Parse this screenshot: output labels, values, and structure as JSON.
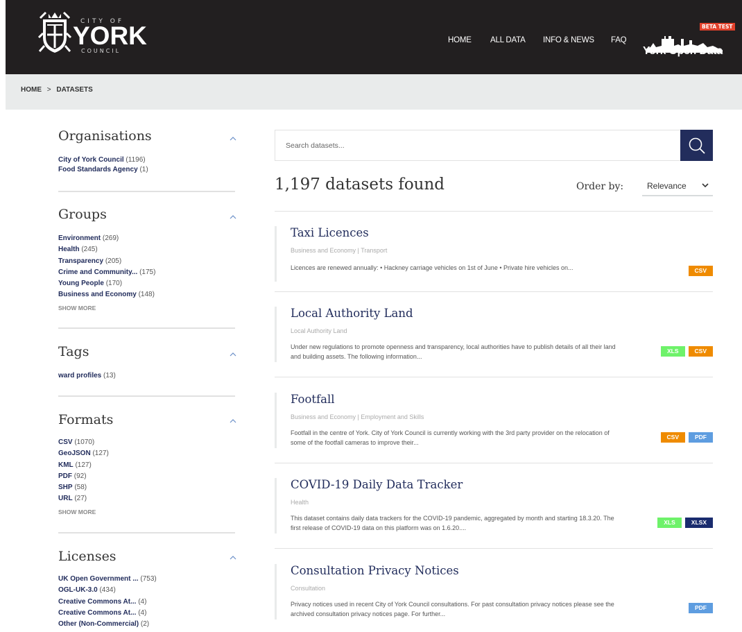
{
  "header": {
    "logo_top": "CITY OF",
    "logo_main": "YORK",
    "logo_bottom": "COUNCIL",
    "nav": [
      "HOME",
      "ALL DATA",
      "INFO & NEWS",
      "FAQ"
    ],
    "brand_title": "York Open Data",
    "beta_badge": "BETA TEST"
  },
  "breadcrumb": {
    "home": "HOME",
    "separator": ">",
    "current": "DATASETS"
  },
  "sidebar": {
    "organisations": {
      "title": "Organisations",
      "items": [
        {
          "label": "City of York Council",
          "count": "(1196)"
        },
        {
          "label": "Food Standards Agency",
          "count": "(1)"
        }
      ]
    },
    "groups": {
      "title": "Groups",
      "items": [
        {
          "label": "Environment",
          "count": "(269)"
        },
        {
          "label": "Health",
          "count": "(245)"
        },
        {
          "label": "Transparency",
          "count": "(205)"
        },
        {
          "label": "Crime and Community...",
          "count": "(175)"
        },
        {
          "label": "Young People",
          "count": "(170)"
        },
        {
          "label": "Business and Economy",
          "count": "(148)"
        }
      ],
      "show_more": "SHOW MORE"
    },
    "tags": {
      "title": "Tags",
      "items": [
        {
          "label": "ward profiles",
          "count": "(13)"
        }
      ]
    },
    "formats": {
      "title": "Formats",
      "items": [
        {
          "label": "CSV",
          "count": "(1070)"
        },
        {
          "label": "GeoJSON",
          "count": "(127)"
        },
        {
          "label": "KML",
          "count": "(127)"
        },
        {
          "label": "PDF",
          "count": "(92)"
        },
        {
          "label": "SHP",
          "count": "(58)"
        },
        {
          "label": "URL",
          "count": "(27)"
        }
      ],
      "show_more": "SHOW MORE"
    },
    "licenses": {
      "title": "Licenses",
      "items": [
        {
          "label": "UK Open Government ...",
          "count": "(753)"
        },
        {
          "label": "OGL-UK-3.0",
          "count": "(434)"
        },
        {
          "label": "Creative Commons At...",
          "count": "(4)"
        },
        {
          "label": "Creative Commons At...",
          "count": "(4)"
        },
        {
          "label": "Other (Non-Commercial)",
          "count": "(2)"
        }
      ]
    }
  },
  "search": {
    "placeholder": "Search datasets..."
  },
  "results": {
    "count_label": "1,197 datasets found",
    "order_label": "Order by:",
    "order_value": "Relevance"
  },
  "datasets": [
    {
      "title": "Taxi Licences",
      "categories": "Business and Economy | Transport",
      "description": "Licences are renewed annually: • Hackney carriage vehicles on 1st of June • Private hire vehicles on...",
      "formats": [
        "CSV"
      ]
    },
    {
      "title": "Local Authority Land",
      "categories": "Local Authority Land",
      "description": "Under new regulations to promote openness and transparency, local authorities have to publish details of all their land and building assets. The following information...",
      "formats": [
        "XLS",
        "CSV"
      ]
    },
    {
      "title": "Footfall",
      "categories": "Business and Economy | Employment and Skills",
      "description": "Footfall in the centre of York. City of York Council is currently working with the 3rd party provider on the relocation of some of the footfall cameras to improve their...",
      "formats": [
        "CSV",
        "PDF"
      ]
    },
    {
      "title": "COVID-19 Daily Data Tracker",
      "categories": "Health",
      "description": "This dataset contains daily data trackers for the COVID-19 pandemic, aggregated by month and starting 18.3.20. The first release of COVID-19 data on this platform was on 1.6.20....",
      "formats": [
        "XLS",
        "XLSX"
      ]
    },
    {
      "title": "Consultation Privacy Notices",
      "categories": "Consultation",
      "description": "Privacy notices used in recent City of York Council consultations. For past consultation privacy notices please see the archived consultation privacy notices page. For further...",
      "formats": [
        "PDF"
      ]
    }
  ],
  "colors": {
    "header_bg": "#221f20",
    "navy": "#222d5c",
    "csv": "#ef8b00",
    "xls": "#6ef26a",
    "pdf": "#5e9de0",
    "xlsx": "#1a2c6e",
    "beta": "#e2412b"
  }
}
